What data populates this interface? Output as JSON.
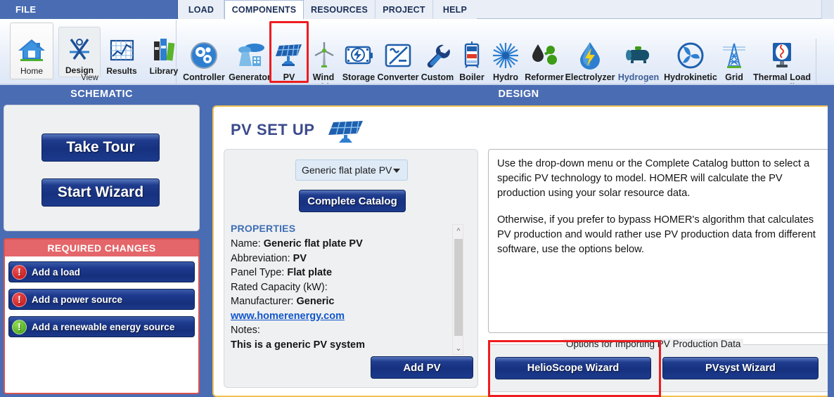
{
  "window": {
    "file_tab": "FILE",
    "tabs": [
      {
        "label": "LOAD",
        "active": false
      },
      {
        "label": "COMPONENTS",
        "active": true
      },
      {
        "label": "RESOURCES",
        "active": false
      },
      {
        "label": "PROJECT",
        "active": false
      },
      {
        "label": "HELP",
        "active": false
      }
    ]
  },
  "ribbon": {
    "view_group_label": "View",
    "home_label": "Home",
    "view_buttons": [
      {
        "label": "Design",
        "icon": "compass-icon",
        "selected": true
      },
      {
        "label": "Results",
        "icon": "chart-icon",
        "selected": false
      },
      {
        "label": "Library",
        "icon": "books-icon",
        "selected": false
      }
    ],
    "components": [
      {
        "label": "Controller",
        "icon": "controller-gears-icon",
        "highlighted": false
      },
      {
        "label": "Generator",
        "icon": "generator-plant-icon",
        "highlighted": false
      },
      {
        "label": "PV",
        "icon": "solar-panel-icon",
        "highlighted": true
      },
      {
        "label": "Wind Turbine",
        "icon": "wind-turbine-icon",
        "highlighted": false
      },
      {
        "label": "Storage",
        "icon": "battery-storage-icon",
        "highlighted": false
      },
      {
        "label": "Converter",
        "icon": "converter-icon",
        "highlighted": false
      },
      {
        "label": "Custom",
        "icon": "wrench-icon",
        "highlighted": false
      },
      {
        "label": "Boiler",
        "icon": "boiler-icon",
        "highlighted": false
      },
      {
        "label": "Hydro",
        "icon": "hydro-turbine-icon",
        "highlighted": false
      },
      {
        "label": "Reformer",
        "icon": "reformer-icon",
        "highlighted": false
      },
      {
        "label": "Electrolyzer",
        "icon": "electrolyzer-drop-icon",
        "highlighted": false
      },
      {
        "label": "Hydrogen Tank",
        "icon": "hydrogen-tank-icon",
        "highlighted": false
      },
      {
        "label": "Hydrokinetic",
        "icon": "hydrokinetic-icon",
        "highlighted": false
      },
      {
        "label": "Grid",
        "icon": "grid-tower-icon",
        "highlighted": false
      },
      {
        "label": "Thermal Load Controller",
        "icon": "thermal-load-icon",
        "highlighted": false
      }
    ]
  },
  "panels": {
    "schematic_header": "SCHEMATIC",
    "design_header": "DESIGN"
  },
  "schematic": {
    "take_tour": "Take Tour",
    "start_wizard": "Start Wizard",
    "required_changes_header": "REQUIRED CHANGES",
    "required_items": [
      {
        "label": "Add a load",
        "status": "red",
        "glyph": "!"
      },
      {
        "label": "Add a power source",
        "status": "red",
        "glyph": "!"
      },
      {
        "label": "Add a renewable energy source",
        "status": "green",
        "glyph": "!"
      }
    ]
  },
  "pv_setup": {
    "title": "PV SET UP",
    "title_icon": "solar-panel-icon",
    "dropdown_value": "Generic flat plate PV",
    "complete_catalog_button": "Complete Catalog",
    "properties_title": "PROPERTIES",
    "properties": [
      {
        "label": "Name:",
        "value": "Generic flat plate PV"
      },
      {
        "label": "Abbreviation:",
        "value": "PV"
      },
      {
        "label": "Panel Type:",
        "value": "Flat plate"
      },
      {
        "label": "Rated Capacity (kW):",
        "value": ""
      },
      {
        "label": "Manufacturer:",
        "value": "Generic"
      }
    ],
    "link": "www.homerenergy.com",
    "notes_label": "Notes:",
    "notes_value": "This is a generic PV system",
    "add_pv_button": "Add PV",
    "scroll_up_icon": "chevron-up-icon",
    "scroll_down_icon": "chevron-down-icon",
    "info_paragraph_1": "Use the drop-down menu or the Complete Catalog button to select a specific PV technology to model. HOMER will calculate the PV production using your solar resource data.",
    "info_paragraph_2": "Otherwise, if you prefer to bypass HOMER's algorithm that calculates PV production and would rather use PV production data from different software, use the options below.",
    "import_group_label": "Options for Importing PV Production Data",
    "helioscope_button": "HelioScope Wizard",
    "pvsyst_button": "PVsyst Wizard"
  },
  "colors": {
    "ribbon_blue": "#4a6cb3",
    "button_navy": "#1b3889",
    "required_red": "#e4666a",
    "highlight_red": "#ee1c20",
    "panel_border_gold": "#f2c153",
    "link_blue": "#1155cc"
  }
}
